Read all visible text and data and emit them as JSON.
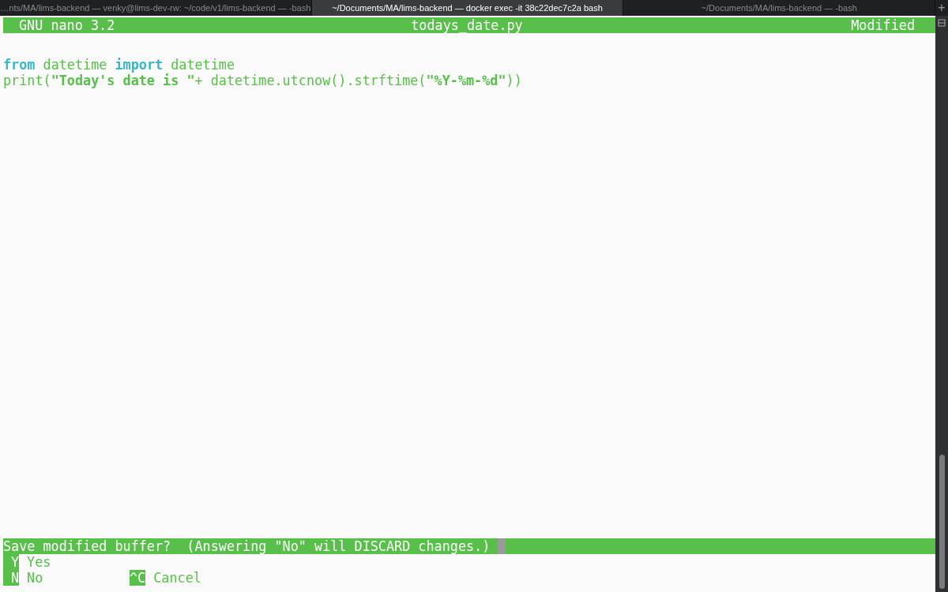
{
  "tabs": [
    {
      "label": "…nts/MA/lims-backend — venky@lims-dev-rw: ~/code/v1/lims-backend — -bash",
      "selected": false
    },
    {
      "label": "~/Documents/MA/lims-backend — docker exec -it 38c22dec7c2a bash",
      "selected": true
    },
    {
      "label": "~/Documents/MA/lims-backend — -bash",
      "selected": false
    }
  ],
  "new_tab": "+",
  "header": {
    "app": "GNU nano 3.2",
    "file": "todays_date.py",
    "status": "Modified"
  },
  "code_lines": [
    [
      {
        "kind": "keyword",
        "text": "from"
      },
      {
        "kind": "plain",
        "text": " datetime "
      },
      {
        "kind": "keyword",
        "text": "import"
      },
      {
        "kind": "plain",
        "text": " datetime"
      }
    ],
    [
      {
        "kind": "plain",
        "text": "print("
      },
      {
        "kind": "string",
        "text": "\"Today's date is \""
      },
      {
        "kind": "plain",
        "text": "+ datetime.utcnow().strftime("
      },
      {
        "kind": "string",
        "text": "\"%Y-%m-%d\""
      },
      {
        "kind": "plain",
        "text": "))"
      }
    ]
  ],
  "prompt": "Save modified buffer?  (Answering \"No\" will DISCARD changes.)",
  "shortcut_rows": [
    [
      {
        "key": "Y",
        "label": "Yes"
      }
    ],
    [
      {
        "key": "N",
        "label": "No"
      },
      {
        "key": "^C",
        "label": "Cancel"
      }
    ]
  ]
}
